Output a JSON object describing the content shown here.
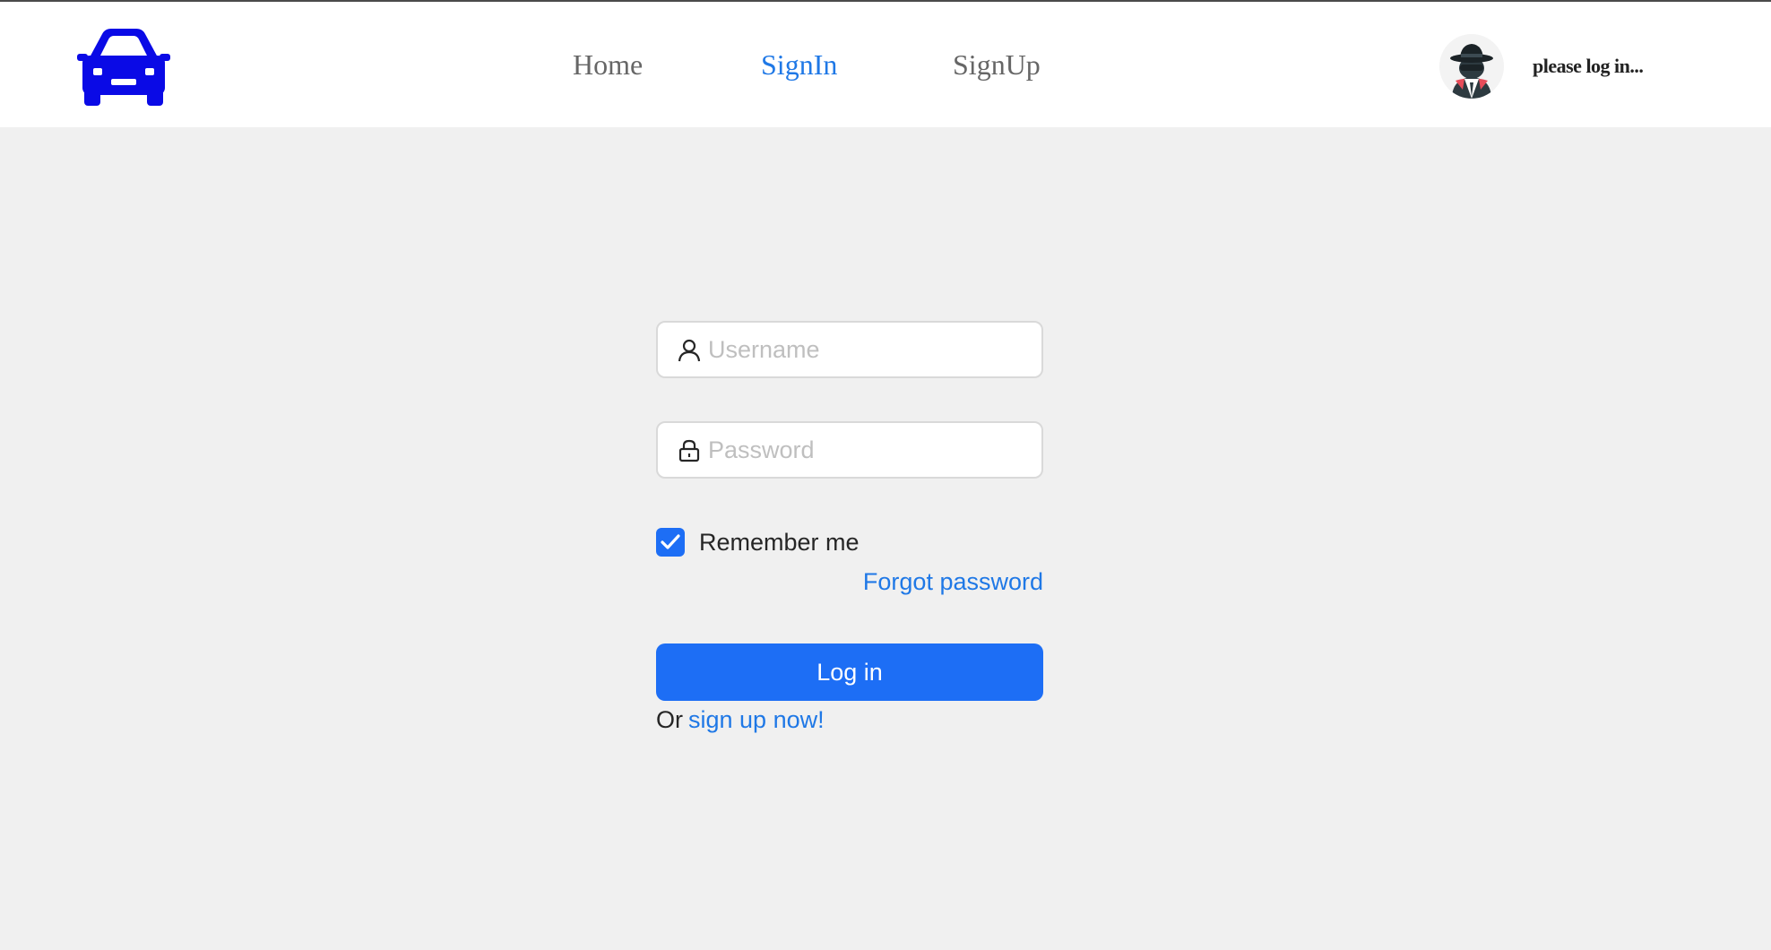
{
  "header": {
    "logo_icon": "car-icon",
    "logo_color": "#0a0ae6",
    "nav": [
      {
        "label": "Home",
        "active": false
      },
      {
        "label": "SignIn",
        "active": true
      },
      {
        "label": "SignUp",
        "active": false
      }
    ],
    "avatar_icon": "spy-avatar-icon",
    "user_status": "please log in..."
  },
  "login_form": {
    "username_placeholder": "Username",
    "username_value": "",
    "username_icon": "user-icon",
    "password_placeholder": "Password",
    "password_value": "",
    "password_icon": "lock-icon",
    "remember_label": "Remember me",
    "remember_checked": true,
    "forgot_label": "Forgot password",
    "login_label": "Log in",
    "signup_prefix": "Or",
    "signup_link": "sign up now!"
  },
  "colors": {
    "accent": "#1d6ef5",
    "link": "#1f78e6",
    "page_background": "#f0f0f0",
    "header_background": "#ffffff"
  }
}
